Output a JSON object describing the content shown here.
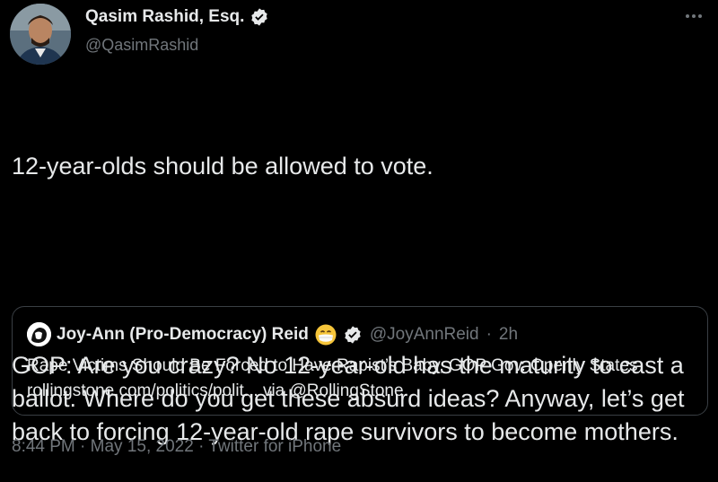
{
  "author": {
    "name": "Qasim Rashid, Esq.",
    "handle": "@QasimRashid"
  },
  "tweet": {
    "line1": "12-year-olds should be allowed to vote.",
    "line2": "GOP: Are you crazy? No 12-year-old has the maturity to cast a ballot. Where do you get these absurd ideas? Anyway, let’s get back to forcing 12-year-old rape survivors to become mothers."
  },
  "quoted": {
    "name": "Joy-Ann (Pro-Democracy) Reid",
    "handle": "@JoyAnnReid",
    "separator": "·",
    "time": "2h",
    "text_line1": "Rape Victims Should Be Forced to Have Rapist’s Baby, GOP Gov. Openly States",
    "text_line2": "rollingstone.com/politics/polit... via @RollingStone"
  },
  "meta": {
    "time": "8:44 PM",
    "date": "May 15, 2022",
    "source": "Twitter for iPhone",
    "separator": "·"
  },
  "icons": {
    "verified": "verified-badge-icon",
    "more": "more-options-icon",
    "emoji": "mask-face-emoji-icon"
  },
  "colors": {
    "background": "#000000",
    "text": "#e7e9ea",
    "muted": "#71767b",
    "border": "#3a3f44"
  }
}
